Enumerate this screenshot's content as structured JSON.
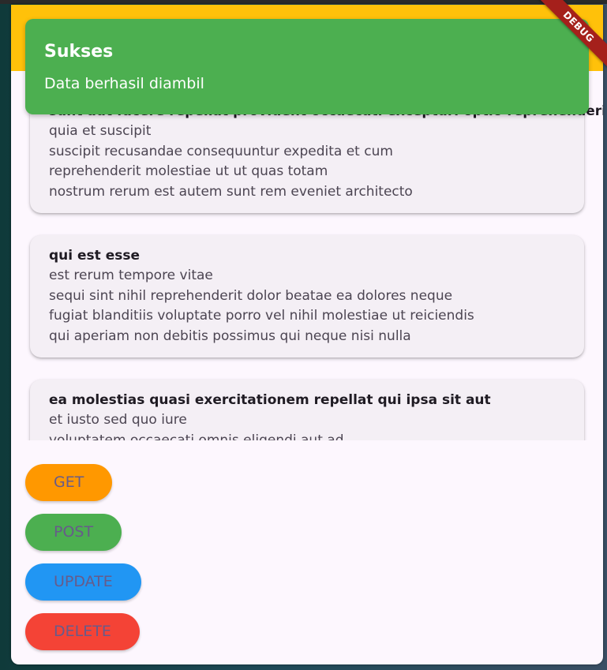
{
  "snackbar": {
    "title": "Sukses",
    "message": "Data berhasil diambil"
  },
  "debug_banner": "DEBUG",
  "posts": [
    {
      "title": "sunt aut facere repellat provident occaecati excepturi optio reprehenderit",
      "body": "quia et suscipit\nsuscipit recusandae consequuntur expedita et cum\nreprehenderit molestiae ut ut quas totam\nnostrum rerum est autem sunt rem eveniet architecto"
    },
    {
      "title": "qui est esse",
      "body": "est rerum tempore vitae\nsequi sint nihil reprehenderit dolor beatae ea dolores neque\nfugiat blanditiis voluptate porro vel nihil molestiae ut reiciendis\nqui aperiam non debitis possimus qui neque nisi nulla"
    },
    {
      "title": "ea molestias quasi exercitationem repellat qui ipsa sit aut",
      "body": "et iusto sed quo iure\nvoluptatem occaecati omnis eligendi aut ad\nvoluptatem doloribus vel accusantium quis pariatur\nmolestiae porro eius odio et labore et velit aut"
    }
  ],
  "buttons": {
    "get": "GET",
    "post": "POST",
    "update": "UPDATE",
    "delete": "DELETE"
  },
  "colors": {
    "appbar": "#ffc10a",
    "get": "#ff9800",
    "post": "#4caf50",
    "update": "#2196f3",
    "delete": "#f44336",
    "snackbar": "#4caf50",
    "button_text": "#675b8a"
  }
}
